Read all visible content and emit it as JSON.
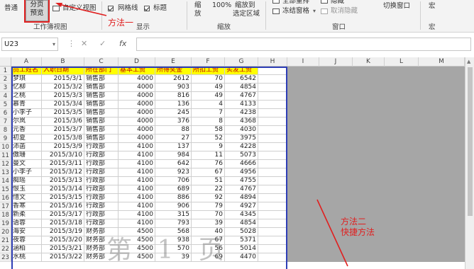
{
  "ribbon": {
    "normal": "普通",
    "page_break_line1": "分页",
    "page_break_line2": "预览",
    "custom_view": "自定义视图",
    "group_workbook_views": "工作簿视图",
    "gridlines": "网格线",
    "headings": "标题",
    "method1": "方法一",
    "group_show": "显示",
    "zoom": "缩",
    "zoom2": "放",
    "zoom100": "100%",
    "zoom_selection_line1": "缩放到",
    "zoom_selection_line2": "选定区域",
    "group_zoom": "缩放",
    "arrange_all": "全部重排",
    "freeze_panes": "冻结窗格",
    "hide": "隐藏",
    "unhide": "取消隐藏",
    "switch_windows": "切换窗口",
    "group_window": "窗口",
    "macros": "宏",
    "group_macros": "宏"
  },
  "formula_bar": {
    "name_box": "U23",
    "cancel": "✕",
    "enter": "✓",
    "fx": "fx",
    "formula": ""
  },
  "columns": [
    "A",
    "B",
    "C",
    "D",
    "E",
    "F",
    "G",
    "H",
    "I",
    "J",
    "K",
    "L",
    "M"
  ],
  "headers": [
    "员工姓名",
    "入职日期",
    "所在部门",
    "基本工资",
    "所得奖金",
    "所扣工资",
    "实发工资"
  ],
  "rows": [
    [
      "梦琪",
      "2015/3/1",
      "销售部",
      "4000",
      "2612",
      "70",
      "6542"
    ],
    [
      "忆柳",
      "2015/3/2",
      "销售部",
      "4000",
      "903",
      "49",
      "4854"
    ],
    [
      "之桃",
      "2015/3/3",
      "销售部",
      "4000",
      "816",
      "49",
      "4767"
    ],
    [
      "慕青",
      "2015/3/4",
      "销售部",
      "4000",
      "136",
      "4",
      "4133"
    ],
    [
      "小李子",
      "2015/3/5",
      "销售部",
      "4000",
      "245",
      "7",
      "4238"
    ],
    [
      "尔岚",
      "2015/3/6",
      "销售部",
      "4000",
      "376",
      "8",
      "4368"
    ],
    [
      "元香",
      "2015/3/7",
      "销售部",
      "4000",
      "88",
      "58",
      "4030"
    ],
    [
      "初夏",
      "2015/3/8",
      "销售部",
      "4000",
      "27",
      "52",
      "3975"
    ],
    [
      "沛菡",
      "2015/3/9",
      "行政部",
      "4100",
      "137",
      "9",
      "4228"
    ],
    [
      "傲珊",
      "2015/3/10",
      "行政部",
      "4100",
      "984",
      "11",
      "5073"
    ],
    [
      "曼文",
      "2015/3/11",
      "行政部",
      "4100",
      "642",
      "76",
      "4666"
    ],
    [
      "小李子",
      "2015/3/12",
      "行政部",
      "4100",
      "923",
      "67",
      "4956"
    ],
    [
      "痴瑶",
      "2015/3/13",
      "行政部",
      "4100",
      "706",
      "51",
      "4755"
    ],
    [
      "恨玉",
      "2015/3/14",
      "行政部",
      "4100",
      "689",
      "22",
      "4767"
    ],
    [
      "惜文",
      "2015/3/15",
      "行政部",
      "4100",
      "886",
      "92",
      "4894"
    ],
    [
      "香寒",
      "2015/3/16",
      "行政部",
      "4100",
      "906",
      "79",
      "4927"
    ],
    [
      "新柔",
      "2015/3/17",
      "行政部",
      "4100",
      "315",
      "70",
      "4345"
    ],
    [
      "语蓉",
      "2015/3/18",
      "行政部",
      "4100",
      "793",
      "39",
      "4854"
    ],
    [
      "海安",
      "2015/3/19",
      "财务部",
      "4500",
      "568",
      "40",
      "5028"
    ],
    [
      "夜蓉",
      "2015/3/20",
      "财务部",
      "4500",
      "938",
      "67",
      "5371"
    ],
    [
      "涵柏",
      "2015/3/21",
      "财务部",
      "4500",
      "570",
      "56",
      "5014"
    ],
    [
      "水桃",
      "2015/3/22",
      "财务部",
      "4500",
      "39",
      "69",
      "4470"
    ]
  ],
  "watermark": "第 1 页",
  "method2_line1": "方法二",
  "method2_line2": "快捷方法",
  "colors": {
    "header_fill": "#ffff00",
    "header_text": "#c00000",
    "page_border": "#2f3fb6",
    "annotation": "#e02020",
    "gray_area": "#a6a6a6"
  }
}
